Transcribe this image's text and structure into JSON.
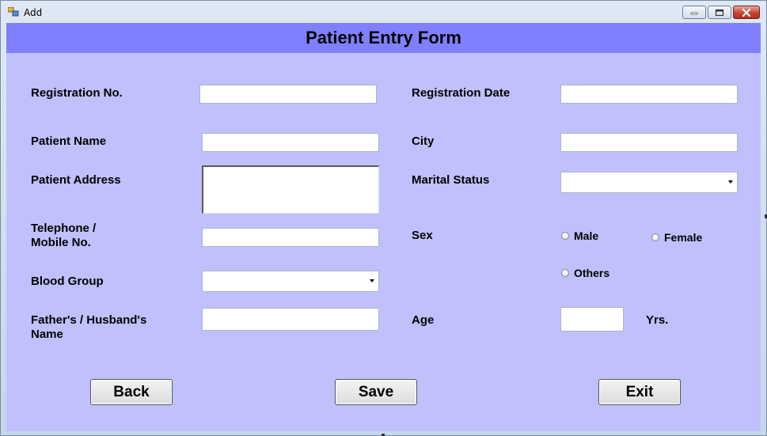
{
  "window": {
    "title": "Add",
    "icon": "app-form-icon",
    "controls": [
      "minimize-icon",
      "maximize-icon",
      "close-icon"
    ]
  },
  "form": {
    "title": "Patient Entry Form",
    "header_color": "#8080ff",
    "background_color": "#c0c0fc"
  },
  "fields": {
    "registration_no": {
      "label": "Registration No.",
      "value": ""
    },
    "registration_date": {
      "label": "Registration Date",
      "value": ""
    },
    "patient_name": {
      "label": "Patient Name",
      "value": ""
    },
    "city": {
      "label": "City",
      "value": ""
    },
    "patient_address": {
      "label": "Patient Address",
      "value": ""
    },
    "marital_status": {
      "label": "Marital Status",
      "value": ""
    },
    "telephone": {
      "label_line1": "Telephone /",
      "label_line2": "Mobile No.",
      "value": ""
    },
    "sex": {
      "label": "Sex",
      "options": [
        "Male",
        "Female",
        "Others"
      ],
      "selected": ""
    },
    "blood_group": {
      "label": "Blood Group",
      "value": ""
    },
    "guardian_name": {
      "label_line1": "Father's / Husband's",
      "label_line2": "Name",
      "value": ""
    },
    "age": {
      "label": "Age",
      "value": "",
      "unit": "Yrs."
    }
  },
  "buttons": {
    "back": "Back",
    "save": "Save",
    "exit": "Exit"
  }
}
